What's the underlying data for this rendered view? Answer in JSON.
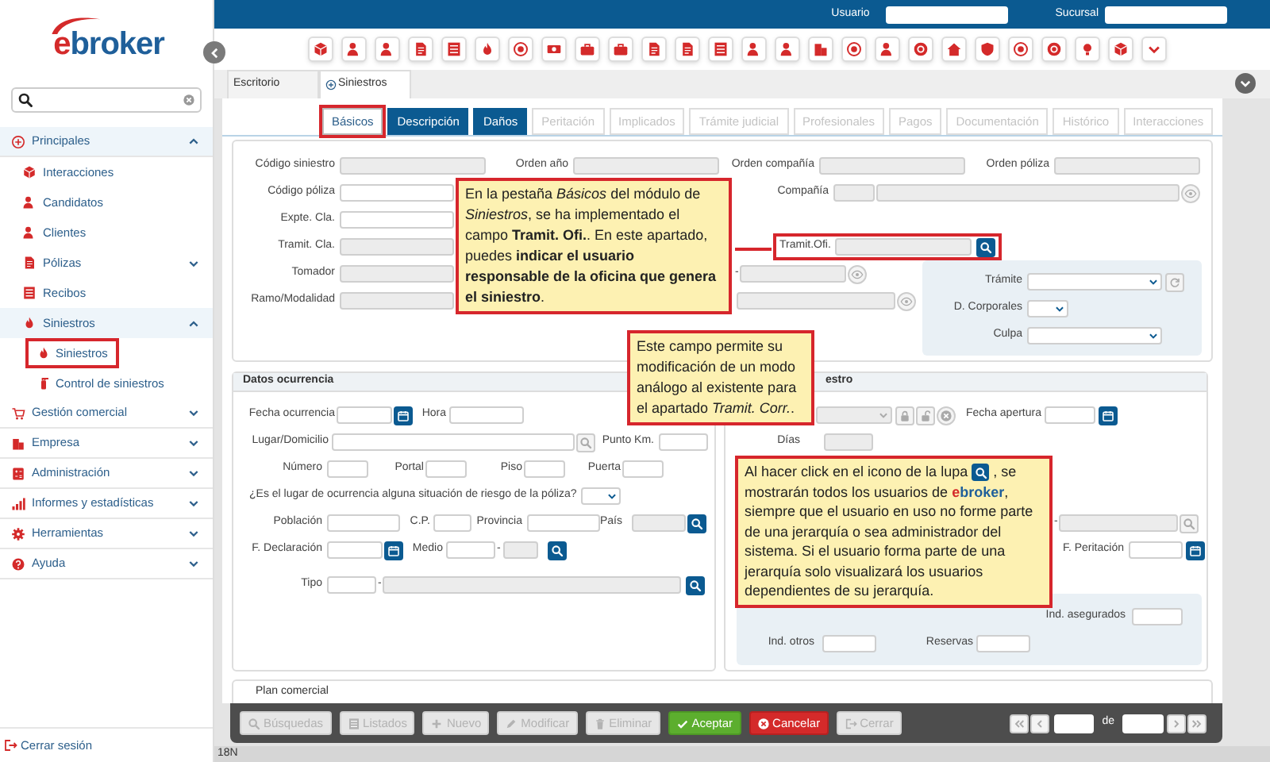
{
  "sidebar": {
    "logo": {
      "accent": "e",
      "rest": "broker"
    },
    "nav": [
      {
        "label": "Principales",
        "expanded": true,
        "children": [
          {
            "label": "Interacciones",
            "kind": "link"
          },
          {
            "label": "Candidatos",
            "kind": "link"
          },
          {
            "label": "Clientes",
            "kind": "link"
          },
          {
            "label": "Pólizas",
            "kind": "group",
            "expanded": false
          },
          {
            "label": "Recibos",
            "kind": "link"
          },
          {
            "label": "Siniestros",
            "kind": "group",
            "expanded": true,
            "children": [
              {
                "label": "Siniestros",
                "highlighted": true
              },
              {
                "label": "Control de siniestros",
                "highlighted": false
              }
            ]
          }
        ]
      },
      {
        "label": "Gestión comercial",
        "expanded": false
      },
      {
        "label": "Empresa",
        "expanded": false
      },
      {
        "label": "Administración",
        "expanded": false
      },
      {
        "label": "Informes y estadísticas",
        "expanded": false
      },
      {
        "label": "Herramientas",
        "expanded": false
      },
      {
        "label": "Ayuda",
        "expanded": false
      }
    ],
    "logout": "Cerrar sesión"
  },
  "header": {
    "user_label": "Usuario",
    "branch_label": "Sucursal"
  },
  "open_tabs": [
    {
      "label": "Escritorio",
      "selected": false
    },
    {
      "label": "Siniestros",
      "selected": true
    }
  ],
  "section_tabs": [
    {
      "label": "Básicos",
      "selected": true,
      "disabled": false,
      "highlighted": true
    },
    {
      "label": "Descripción",
      "selected": false,
      "disabled": false,
      "highlighted": false
    },
    {
      "label": "Daños",
      "selected": false,
      "disabled": false,
      "highlighted": false
    },
    {
      "label": "Peritación",
      "selected": false,
      "disabled": true,
      "highlighted": false
    },
    {
      "label": "Implicados",
      "selected": false,
      "disabled": true,
      "highlighted": false
    },
    {
      "label": "Trámite judicial",
      "selected": false,
      "disabled": true,
      "highlighted": false
    },
    {
      "label": "Profesionales",
      "selected": false,
      "disabled": true,
      "highlighted": false
    },
    {
      "label": "Pagos",
      "selected": false,
      "disabled": true,
      "highlighted": false
    },
    {
      "label": "Documentación",
      "selected": false,
      "disabled": true,
      "highlighted": false
    },
    {
      "label": "Histórico",
      "selected": false,
      "disabled": true,
      "highlighted": false
    },
    {
      "label": "Interacciones",
      "selected": false,
      "disabled": true,
      "highlighted": false
    }
  ],
  "basic_fields": {
    "codigo_siniestro": {
      "label": "Código siniestro"
    },
    "orden_ano": {
      "label": "Orden año"
    },
    "orden_compania": {
      "label": "Orden compañía"
    },
    "orden_poliza": {
      "label": "Orden póliza"
    },
    "codigo_poliza": {
      "label": "Código póliza"
    },
    "compania": {
      "label": "Compañía"
    },
    "expte_cla": {
      "label": "Expte. Cla."
    },
    "tramit_cla": {
      "label": "Tramit. Cla."
    },
    "tramit_ofi": {
      "label": "Tramit.Ofi.",
      "highlighted": true
    },
    "tomador": {
      "label": "Tomador",
      "separator": "-"
    },
    "ramo_modalidad": {
      "label": "Ramo/Modalidad"
    },
    "tramite": {
      "label": "Trámite"
    },
    "d_corporales": {
      "label": "D. Corporales"
    },
    "culpa": {
      "label": "Culpa"
    }
  },
  "occurrence_panel": {
    "title": "Datos ocurrencia",
    "fecha_ocurrencia": "Fecha ocurrencia",
    "hora": "Hora",
    "lugar": "Lugar/Domicilio",
    "punto_km": "Punto Km.",
    "numero": "Número",
    "portal": "Portal",
    "piso": "Piso",
    "puerta": "Puerta",
    "riesgo": "¿Es el lugar de ocurrencia alguna situación de riesgo de la póliza?",
    "poblacion": "Población",
    "cp": "C.P.",
    "provincia": "Provincia",
    "pais": "País",
    "f_declaracion": "F. Declaración",
    "medio": "Medio",
    "medio_separator": "-",
    "tipo": "Tipo",
    "tipo_separator": "-"
  },
  "registry_panel": {
    "title": "estro",
    "fecha_apertura": "Fecha apertura",
    "dias": "Días",
    "range_separator": "-",
    "f_peritacion": "F. Peritación",
    "ind_asegurados": "Ind. asegurados",
    "ind_otros": "Ind. otros",
    "reservas": "Reservas"
  },
  "plan_panel": {
    "title": "Plan comercial"
  },
  "actions": [
    {
      "label": "Búsquedas",
      "kind": "search",
      "disabled": true
    },
    {
      "label": "Listados",
      "kind": "list",
      "disabled": true
    },
    {
      "label": "Nuevo",
      "kind": "plus",
      "disabled": true
    },
    {
      "label": "Modificar",
      "kind": "pencil",
      "disabled": true
    },
    {
      "label": "Eliminar",
      "kind": "trash",
      "disabled": true
    },
    {
      "label": "Aceptar",
      "kind": "check",
      "disabled": false
    },
    {
      "label": "Cancelar",
      "kind": "x-circle",
      "disabled": false
    },
    {
      "label": "Cerrar",
      "kind": "exit",
      "disabled": true
    }
  ],
  "pager": {
    "of_label": "de"
  },
  "status_bar": "18N",
  "callouts": [
    {
      "kind": "plain",
      "text": "En la pestaña *Básicos* del módulo de *Siniestros*, se ha implementado el campo **Tramit. Ofi.**. En este apartado, puedes **indicar el usuario responsable de la oficina que genera el siniestro**."
    },
    {
      "kind": "plain",
      "text": "Este campo permite su modificación de un modo análogo al existente para el apartado *Tramit. Corr.*."
    },
    {
      "kind": "with_icon",
      "before": "Al hacer click en el icono de la lupa",
      "after": ", se mostrarán todos los usuarios de",
      "brand": {
        "accent": "e",
        "rest": "broker"
      },
      "end": ", siempre que el usuario en uso no forme parte de una jerarquía o sea administrador del sistema. Si el usuario forma parte de una jerarquía solo visualizará los usuarios dependientes de su jerarquía."
    }
  ]
}
